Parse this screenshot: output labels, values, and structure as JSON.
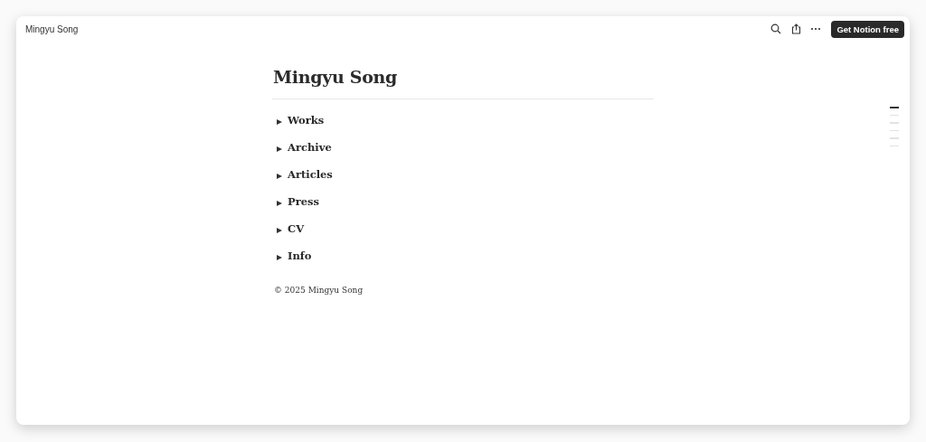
{
  "topbar": {
    "title": "Mingyu Song",
    "cta": "Get Notion free"
  },
  "page": {
    "title": "Mingyu Song",
    "sections": [
      {
        "title": "Works",
        "expanded": false
      },
      {
        "title": "Archive",
        "expanded": false
      },
      {
        "title": "Articles",
        "expanded": false
      },
      {
        "title": "Press",
        "expanded": false
      },
      {
        "title": "CV",
        "expanded": false
      },
      {
        "title": "Info",
        "expanded": false
      }
    ],
    "footer": "© 2025 Mingyu Song"
  },
  "outline": [
    {
      "selected": true
    },
    {
      "selected": false
    },
    {
      "selected": false
    },
    {
      "selected": false
    },
    {
      "selected": false
    },
    {
      "selected": false
    }
  ]
}
